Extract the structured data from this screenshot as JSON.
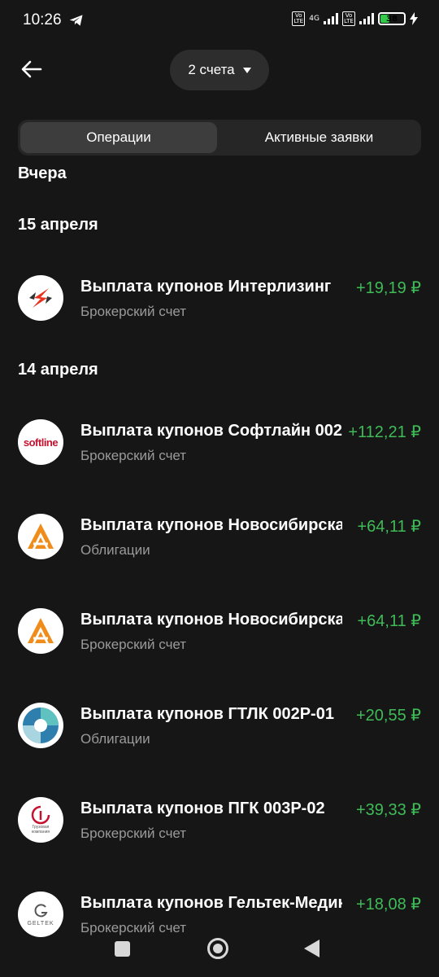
{
  "status_bar": {
    "time": "10:26",
    "network": "4G",
    "battery": "38",
    "battery_level": 0.38,
    "volte_label": "Vo LTE"
  },
  "header": {
    "accounts_label": "2 счета"
  },
  "tabs": [
    {
      "label": "Операции",
      "active": true
    },
    {
      "label": "Активные заявки",
      "active": false
    }
  ],
  "sections": [
    {
      "title": "Вчера"
    },
    {
      "title": "15 апреля"
    },
    {
      "title": "14 апреля"
    }
  ],
  "operations": [
    {
      "title": "Выплата купонов Интерлизинг",
      "subtitle": "Брокерский счет",
      "amount": "+19,19 ₽",
      "logo": "interleasing-logo",
      "logo_text": ""
    },
    {
      "title": "Выплата купонов Софтлайн 002",
      "subtitle": "Брокерский счет",
      "amount": "+112,21 ₽",
      "logo": "softline-logo",
      "logo_text": "softline"
    },
    {
      "title": "Выплата купонов Новосибирская",
      "subtitle": "Облигации",
      "amount": "+64,11 ₽",
      "logo": "novosibirsk-logo",
      "logo_text": ""
    },
    {
      "title": "Выплата купонов Новосибирская",
      "subtitle": "Брокерский счет",
      "amount": "+64,11 ₽",
      "logo": "novosibirsk-logo",
      "logo_text": ""
    },
    {
      "title": "Выплата купонов ГТЛК 002Р-01",
      "subtitle": "Облигации",
      "amount": "+20,55 ₽",
      "logo": "gtlk-logo",
      "logo_text": ""
    },
    {
      "title": "Выплата купонов ПГК 003Р-02",
      "subtitle": "Брокерский счет",
      "amount": "+39,33 ₽",
      "logo": "pgk-logo",
      "logo_text": "Грузовая компания"
    },
    {
      "title": "Выплата купонов Гельтек-Медика",
      "subtitle": "Брокерский счет",
      "amount": "+18,08 ₽",
      "logo": "geltek-logo",
      "logo_text": "GELTEK"
    }
  ],
  "colors": {
    "background": "#161616",
    "positive": "#3fbb57",
    "secondary_text": "#9a9a9a"
  }
}
